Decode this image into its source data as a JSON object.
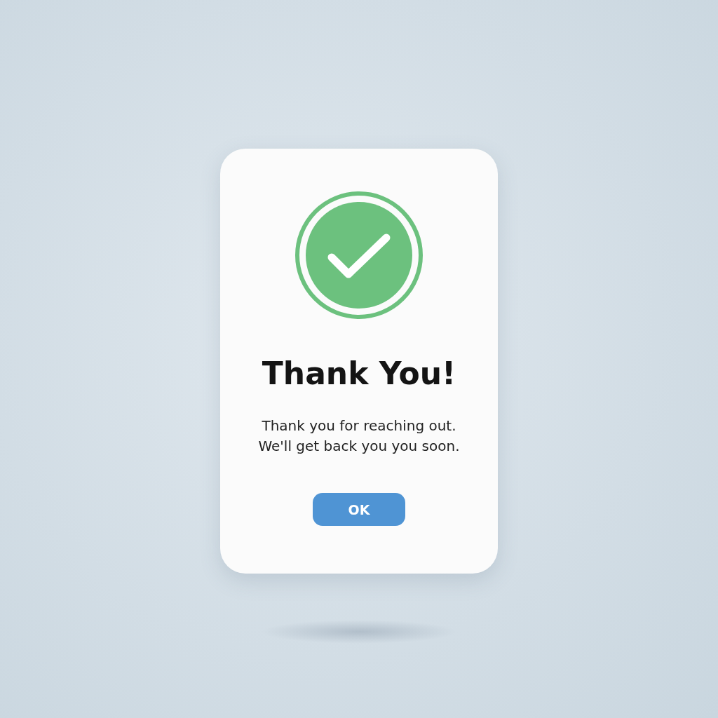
{
  "dialog": {
    "title": "Thank You!",
    "message_lines": [
      "Thank you for reaching out.",
      "We'll get back you you soon."
    ],
    "buttons": [
      {
        "label": "OK",
        "kind": "primary"
      }
    ]
  }
}
